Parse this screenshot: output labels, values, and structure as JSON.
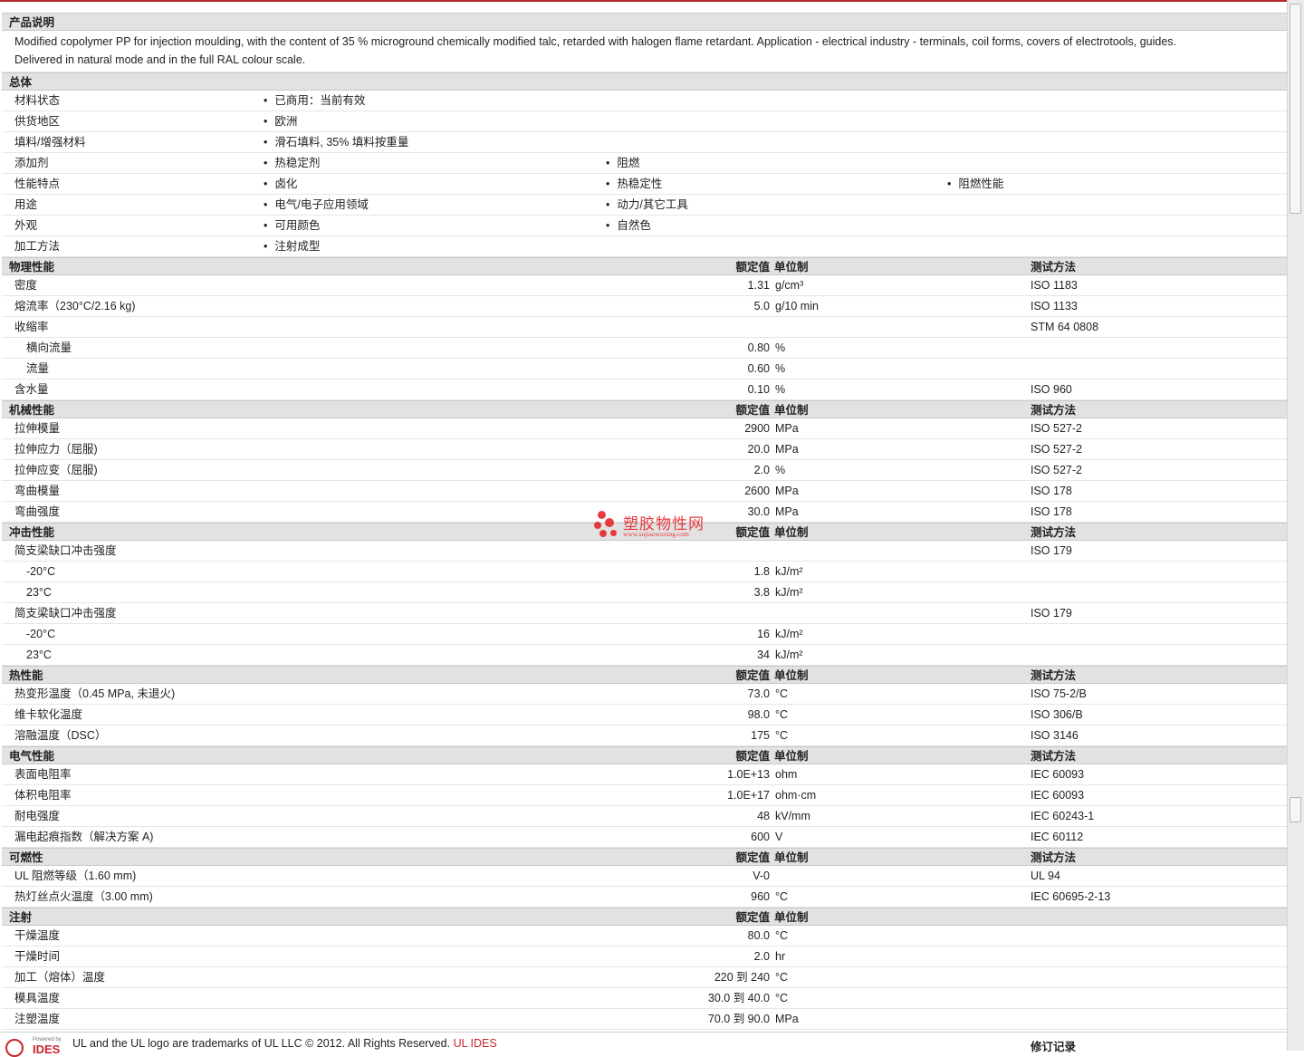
{
  "description_section": {
    "title": "产品说明",
    "text_line1": "Modified copolymer PP for injection moulding, with the content of 35 % microground chemically modified talc, retarded with halogen flame retardant. Application - electrical industry - terminals, coil forms, covers of electrotools, guides.",
    "text_line2": "Delivered in natural mode and in the full RAL colour scale."
  },
  "general_section": {
    "title": "总体",
    "rows": [
      {
        "label": "材料状态",
        "items": [
          "已商用：当前有效"
        ]
      },
      {
        "label": "供货地区",
        "items": [
          "欧洲"
        ]
      },
      {
        "label": "填料/增强材料",
        "items": [
          "滑石填料, 35% 填料按重量"
        ]
      },
      {
        "label": "添加剂",
        "items": [
          "热稳定剂",
          "阻燃"
        ]
      },
      {
        "label": "性能特点",
        "items": [
          "卤化",
          "热稳定性",
          "阻燃性能"
        ]
      },
      {
        "label": "用途",
        "items": [
          "电气/电子应用领域",
          "动力/其它工具"
        ]
      },
      {
        "label": "外观",
        "items": [
          "可用颜色",
          "自然色"
        ]
      },
      {
        "label": "加工方法",
        "items": [
          "注射成型"
        ]
      }
    ]
  },
  "headers": {
    "value": "额定值",
    "unit": "单位制",
    "test": "测试方法"
  },
  "physical": {
    "title": "物理性能",
    "rows": [
      {
        "label": "密度",
        "value": "1.31",
        "unit": "g/cm³",
        "test": "ISO 1183"
      },
      {
        "label": "熔流率（230°C/2.16 kg)",
        "value": "5.0",
        "unit": "g/10 min",
        "test": "ISO 1133"
      },
      {
        "label": "收缩率",
        "value": "",
        "unit": "",
        "test": "STM 64 0808"
      },
      {
        "label": "横向流量",
        "value": "0.80",
        "unit": "%",
        "test": "",
        "sub": true
      },
      {
        "label": "流量",
        "value": "0.60",
        "unit": "%",
        "test": "",
        "sub": true
      },
      {
        "label": "含水量",
        "value": "0.10",
        "unit": "%",
        "test": "ISO 960"
      }
    ]
  },
  "mechanical": {
    "title": "机械性能",
    "rows": [
      {
        "label": "拉伸模量",
        "value": "2900",
        "unit": "MPa",
        "test": "ISO 527-2"
      },
      {
        "label": "拉伸应力（屈服)",
        "value": "20.0",
        "unit": "MPa",
        "test": "ISO 527-2"
      },
      {
        "label": "拉伸应变（屈服)",
        "value": "2.0",
        "unit": "%",
        "test": "ISO 527-2"
      },
      {
        "label": "弯曲模量",
        "value": "2600",
        "unit": "MPa",
        "test": "ISO 178"
      },
      {
        "label": "弯曲强度",
        "value": "30.0",
        "unit": "MPa",
        "test": "ISO 178"
      }
    ]
  },
  "impact": {
    "title": "冲击性能",
    "rows": [
      {
        "label": "简支梁缺口冲击强度",
        "value": "",
        "unit": "",
        "test": "ISO 179"
      },
      {
        "label": "-20°C",
        "value": "1.8",
        "unit": "kJ/m²",
        "test": "",
        "sub": true
      },
      {
        "label": "23°C",
        "value": "3.8",
        "unit": "kJ/m²",
        "test": "",
        "sub": true
      },
      {
        "label": "简支梁缺口冲击强度",
        "value": "",
        "unit": "",
        "test": "ISO 179"
      },
      {
        "label": "-20°C",
        "value": "16",
        "unit": "kJ/m²",
        "test": "",
        "sub": true
      },
      {
        "label": "23°C",
        "value": "34",
        "unit": "kJ/m²",
        "test": "",
        "sub": true
      }
    ]
  },
  "thermal": {
    "title": "热性能",
    "rows": [
      {
        "label": "热变形温度（0.45 MPa, 未退火)",
        "value": "73.0",
        "unit": "°C",
        "test": "ISO 75-2/B"
      },
      {
        "label": "维卡软化温度",
        "value": "98.0",
        "unit": "°C",
        "test": "ISO 306/B"
      },
      {
        "label": "溶融温度（DSC）",
        "value": "175",
        "unit": "°C",
        "test": "ISO 3146"
      }
    ]
  },
  "electrical": {
    "title": "电气性能",
    "rows": [
      {
        "label": "表面电阻率",
        "value": "1.0E+13",
        "unit": "ohm",
        "test": "IEC 60093"
      },
      {
        "label": "体积电阻率",
        "value": "1.0E+17",
        "unit": "ohm·cm",
        "test": "IEC 60093"
      },
      {
        "label": "耐电强度",
        "value": "48",
        "unit": "kV/mm",
        "test": "IEC 60243-1"
      },
      {
        "label": "漏电起痕指数（解决方案 A)",
        "value": "600",
        "unit": "V",
        "test": "IEC 60112"
      }
    ]
  },
  "flammability": {
    "title": "可燃性",
    "rows": [
      {
        "label": "UL 阻燃等级（1.60 mm)",
        "value": "V-0",
        "unit": "",
        "test": "UL 94"
      },
      {
        "label": "热灯丝点火温度（3.00 mm)",
        "value": "960",
        "unit": "°C",
        "test": "IEC 60695-2-13"
      }
    ]
  },
  "injection": {
    "title": "注射",
    "rows": [
      {
        "label": "干燥温度",
        "value": "80.0",
        "unit": "°C",
        "test": ""
      },
      {
        "label": "干燥时间",
        "value": "2.0",
        "unit": "hr",
        "test": ""
      },
      {
        "label": "加工（熔体）温度",
        "value": "220 到  240",
        "unit": "°C",
        "test": ""
      },
      {
        "label": "模具温度",
        "value": "30.0 到  40.0",
        "unit": "°C",
        "test": ""
      },
      {
        "label": "注塑温度",
        "value": "70.0 到  90.0",
        "unit": "MPa",
        "test": ""
      }
    ]
  },
  "watermark": {
    "name": "塑胶物性网",
    "url": "www.sujiaowuxing.com"
  },
  "footer": {
    "powered": "Powered by",
    "logo": "IDES",
    "text": "UL and the UL logo are trademarks of UL LLC © 2012. All Rights Reserved.",
    "link": "UL IDES",
    "revision": "修订记录"
  },
  "colors": {
    "accent": "#b3262b",
    "section_bg": "#e2e2e2",
    "watermark": "#e8262b"
  }
}
